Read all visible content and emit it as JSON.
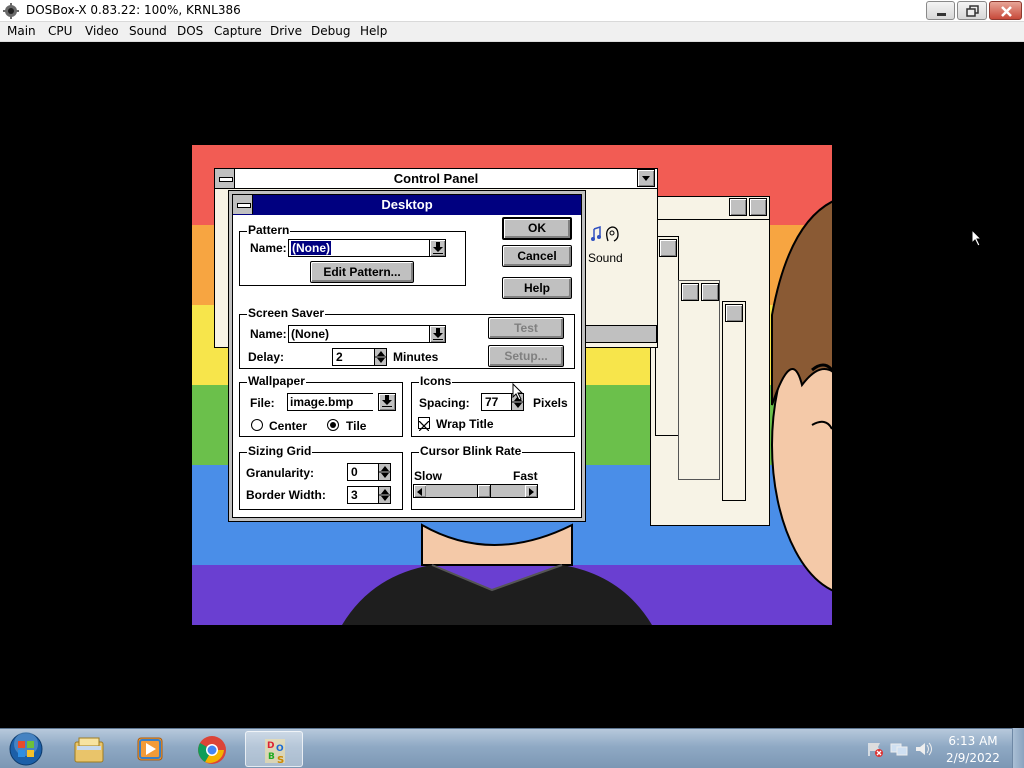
{
  "host_window": {
    "title": "DOSBox-X 0.83.22: 100%, KRNL386",
    "icon": "dosbox-app-icon",
    "controls": [
      "minimize-icon",
      "maximize-icon",
      "close-icon"
    ]
  },
  "host_menu": [
    "Main",
    "CPU",
    "Video",
    "Sound",
    "DOS",
    "Capture",
    "Drive",
    "Debug",
    "Help"
  ],
  "control_panel": {
    "title": "Control Panel",
    "sound_icon_label": "Sound"
  },
  "desktop_dialog": {
    "title": "Desktop",
    "buttons": {
      "ok": "OK",
      "cancel": "Cancel",
      "help": "Help",
      "test": "Test",
      "setup": "Setup..."
    },
    "pattern": {
      "group_label": "Pattern",
      "name_label": "Name:",
      "name_value": "(None)",
      "edit_button": "Edit Pattern..."
    },
    "screen_saver": {
      "group_label": "Screen Saver",
      "name_label": "Name:",
      "name_value": "(None)",
      "delay_label": "Delay:",
      "delay_value": "2",
      "delay_unit": "Minutes"
    },
    "wallpaper": {
      "group_label": "Wallpaper",
      "file_label": "File:",
      "file_value": "image.bmp",
      "center_label": "Center",
      "tile_label": "Tile",
      "selected": "Tile"
    },
    "icons": {
      "group_label": "Icons",
      "spacing_label": "Spacing:",
      "spacing_value": "77",
      "spacing_unit": "Pixels",
      "wrap_title_label": "Wrap Title",
      "wrap_title_checked": true
    },
    "sizing_grid": {
      "group_label": "Sizing Grid",
      "granularity_label": "Granularity:",
      "granularity_value": "0",
      "border_width_label": "Border Width:",
      "border_width_value": "3"
    },
    "cursor_blink": {
      "group_label": "Cursor Blink Rate",
      "slow_label": "Slow",
      "fast_label": "Fast",
      "rate_fraction": 0.6
    }
  },
  "taskbar": {
    "pinned": [
      "windows-explorer-icon",
      "media-player-icon",
      "chrome-icon",
      "dosbox-icon"
    ],
    "active": "dosbox-icon",
    "tray": [
      "action-center-flag-icon",
      "network-icon",
      "volume-icon"
    ],
    "time": "6:13 AM",
    "date": "2/9/2022"
  },
  "colors": {
    "win31_active_title": "#000080",
    "win31_face": "#c0c0c0",
    "rainbow": [
      "#f25c54",
      "#f7a541",
      "#f7e54b",
      "#6bc04b",
      "#4a8ee8",
      "#6a3fd1"
    ]
  }
}
